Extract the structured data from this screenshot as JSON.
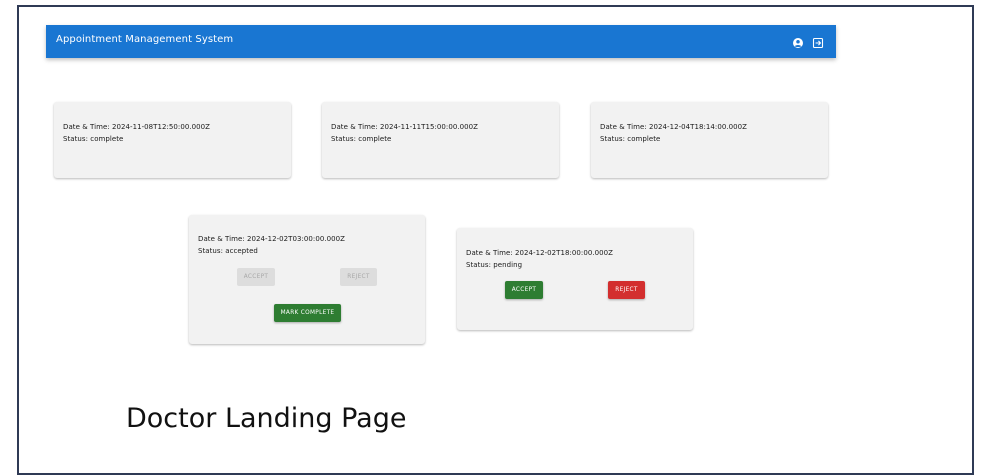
{
  "appbar": {
    "title": "Appointment Management System",
    "icons": [
      "account-circle-icon",
      "logout-icon"
    ]
  },
  "appointments": [
    {
      "datetime": "Date & Time: 2024-11-08T12:50:00.000Z",
      "status": "Status: complete"
    },
    {
      "datetime": "Date & Time: 2024-11-11T15:00:00.000Z",
      "status": "Status: complete"
    },
    {
      "datetime": "Date & Time: 2024-12-04T18:14:00.000Z",
      "status": "Status: complete"
    },
    {
      "datetime": "Date & Time: 2024-12-02T03:00:00.000Z",
      "status": "Status: accepted",
      "accept_label": "ACCEPT",
      "reject_label": "REJECT",
      "complete_label": "MARK COMPLETE"
    },
    {
      "datetime": "Date & Time: 2024-12-02T18:00:00.000Z",
      "status": "Status: pending",
      "accept_label": "ACCEPT",
      "reject_label": "REJECT"
    }
  ],
  "caption": "Doctor Landing Page",
  "colors": {
    "appbar": "#1976d2",
    "accept": "#2e7d32",
    "reject": "#d32f2f",
    "card": "#f2f2f2",
    "disabled": "#dddddd"
  }
}
